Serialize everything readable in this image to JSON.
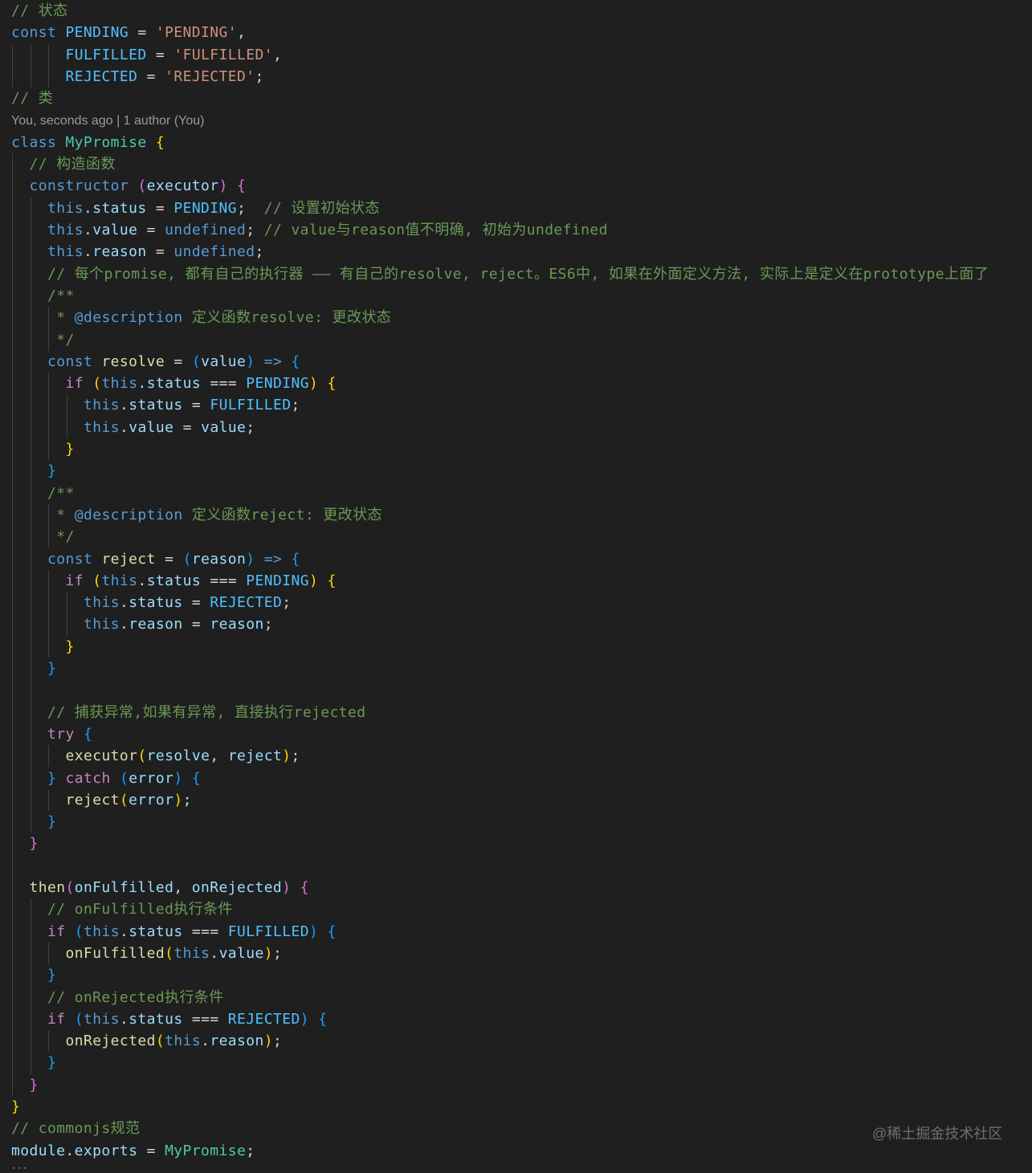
{
  "theme": {
    "background": "#1f1f1f",
    "comment": "#6a9955",
    "keyword_blue": "#569cd6",
    "keyword_control": "#c586c0",
    "variable": "#9cdcfe",
    "constant": "#4fc1ff",
    "string": "#ce9178",
    "function": "#dcdcaa",
    "class_name": "#4ec9b0",
    "text": "#d4d4d4",
    "bracket_gold": "#ffd700",
    "bracket_purple": "#da70d6",
    "bracket_blue": "#179fff",
    "docblock_tag": "#569cd6",
    "indent_guide": "#404040"
  },
  "codelens": {
    "label": "You, seconds ago | 1 author (You)",
    "after_line": 5
  },
  "watermark": "@稀土掘金技术社区",
  "lines": [
    {
      "indent": 0,
      "tokens": [
        [
          "// 状态",
          "comment"
        ]
      ]
    },
    {
      "indent": 0,
      "tokens": [
        [
          "const",
          "kw"
        ],
        [
          " ",
          "t"
        ],
        [
          "PENDING",
          "const"
        ],
        [
          " = ",
          "t"
        ],
        [
          "'PENDING'",
          "str"
        ],
        [
          ",",
          "t"
        ]
      ]
    },
    {
      "indent": 6,
      "tokens": [
        [
          "FULFILLED",
          "const"
        ],
        [
          " = ",
          "t"
        ],
        [
          "'FULFILLED'",
          "str"
        ],
        [
          ",",
          "t"
        ]
      ]
    },
    {
      "indent": 6,
      "tokens": [
        [
          "REJECTED",
          "const"
        ],
        [
          " = ",
          "t"
        ],
        [
          "'REJECTED'",
          "str"
        ],
        [
          ";",
          "t"
        ]
      ]
    },
    {
      "indent": 0,
      "tokens": [
        [
          "// 类",
          "comment"
        ]
      ]
    },
    {
      "indent": 0,
      "tokens": [
        [
          "class",
          "kw"
        ],
        [
          " ",
          "t"
        ],
        [
          "MyPromise",
          "cls"
        ],
        [
          " ",
          "t"
        ],
        [
          "{",
          "b1"
        ]
      ]
    },
    {
      "indent": 2,
      "tokens": [
        [
          "// 构造函数",
          "comment"
        ]
      ]
    },
    {
      "indent": 2,
      "tokens": [
        [
          "constructor",
          "kw"
        ],
        [
          " ",
          "t"
        ],
        [
          "(",
          "b2"
        ],
        [
          "executor",
          "var"
        ],
        [
          ")",
          "b2"
        ],
        [
          " ",
          "t"
        ],
        [
          "{",
          "b2"
        ]
      ]
    },
    {
      "indent": 4,
      "tokens": [
        [
          "this",
          "kw"
        ],
        [
          ".",
          "t"
        ],
        [
          "status",
          "var"
        ],
        [
          " = ",
          "t"
        ],
        [
          "PENDING",
          "const"
        ],
        [
          ";  ",
          "t"
        ],
        [
          "// 设置初始状态",
          "comment"
        ]
      ]
    },
    {
      "indent": 4,
      "tokens": [
        [
          "this",
          "kw"
        ],
        [
          ".",
          "t"
        ],
        [
          "value",
          "var"
        ],
        [
          " = ",
          "t"
        ],
        [
          "undefined",
          "kw"
        ],
        [
          "; ",
          "t"
        ],
        [
          "// value与reason值不明确, 初始为undefined",
          "comment"
        ]
      ]
    },
    {
      "indent": 4,
      "tokens": [
        [
          "this",
          "kw"
        ],
        [
          ".",
          "t"
        ],
        [
          "reason",
          "var"
        ],
        [
          " = ",
          "t"
        ],
        [
          "undefined",
          "kw"
        ],
        [
          ";",
          "t"
        ]
      ]
    },
    {
      "indent": 4,
      "tokens": [
        [
          "// 每个promise, 都有自己的执行器 —— 有自己的resolve, reject。ES6中, 如果在外面定义方法, 实际上是定义在prototype上面了",
          "comment"
        ]
      ]
    },
    {
      "indent": 4,
      "tokens": [
        [
          "/**",
          "comment"
        ]
      ]
    },
    {
      "indent": 5,
      "tokens": [
        [
          "* ",
          "comment"
        ],
        [
          "@description",
          "tag"
        ],
        [
          " 定义函数resolve: 更改状态",
          "comment"
        ]
      ]
    },
    {
      "indent": 5,
      "tokens": [
        [
          "*/",
          "comment"
        ]
      ]
    },
    {
      "indent": 4,
      "tokens": [
        [
          "const",
          "kw"
        ],
        [
          " ",
          "t"
        ],
        [
          "resolve",
          "func"
        ],
        [
          " = ",
          "t"
        ],
        [
          "(",
          "b3"
        ],
        [
          "value",
          "var"
        ],
        [
          ")",
          "b3"
        ],
        [
          " ",
          "t"
        ],
        [
          "=>",
          "kw"
        ],
        [
          " ",
          "t"
        ],
        [
          "{",
          "b3"
        ]
      ]
    },
    {
      "indent": 6,
      "tokens": [
        [
          "if",
          "ctl"
        ],
        [
          " ",
          "t"
        ],
        [
          "(",
          "b1"
        ],
        [
          "this",
          "kw"
        ],
        [
          ".",
          "t"
        ],
        [
          "status",
          "var"
        ],
        [
          " === ",
          "t"
        ],
        [
          "PENDING",
          "const"
        ],
        [
          ")",
          "b1"
        ],
        [
          " ",
          "t"
        ],
        [
          "{",
          "b1"
        ]
      ]
    },
    {
      "indent": 8,
      "tokens": [
        [
          "this",
          "kw"
        ],
        [
          ".",
          "t"
        ],
        [
          "status",
          "var"
        ],
        [
          " = ",
          "t"
        ],
        [
          "FULFILLED",
          "const"
        ],
        [
          ";",
          "t"
        ]
      ]
    },
    {
      "indent": 8,
      "tokens": [
        [
          "this",
          "kw"
        ],
        [
          ".",
          "t"
        ],
        [
          "value",
          "var"
        ],
        [
          " = ",
          "t"
        ],
        [
          "value",
          "var"
        ],
        [
          ";",
          "t"
        ]
      ]
    },
    {
      "indent": 6,
      "tokens": [
        [
          "}",
          "b1"
        ]
      ]
    },
    {
      "indent": 4,
      "tokens": [
        [
          "}",
          "b3"
        ]
      ]
    },
    {
      "indent": 4,
      "tokens": [
        [
          "/**",
          "comment"
        ]
      ]
    },
    {
      "indent": 5,
      "tokens": [
        [
          "* ",
          "comment"
        ],
        [
          "@description",
          "tag"
        ],
        [
          " 定义函数reject: 更改状态",
          "comment"
        ]
      ]
    },
    {
      "indent": 5,
      "tokens": [
        [
          "*/",
          "comment"
        ]
      ]
    },
    {
      "indent": 4,
      "tokens": [
        [
          "const",
          "kw"
        ],
        [
          " ",
          "t"
        ],
        [
          "reject",
          "func"
        ],
        [
          " = ",
          "t"
        ],
        [
          "(",
          "b3"
        ],
        [
          "reason",
          "var"
        ],
        [
          ")",
          "b3"
        ],
        [
          " ",
          "t"
        ],
        [
          "=>",
          "kw"
        ],
        [
          " ",
          "t"
        ],
        [
          "{",
          "b3"
        ]
      ]
    },
    {
      "indent": 6,
      "tokens": [
        [
          "if",
          "ctl"
        ],
        [
          " ",
          "t"
        ],
        [
          "(",
          "b1"
        ],
        [
          "this",
          "kw"
        ],
        [
          ".",
          "t"
        ],
        [
          "status",
          "var"
        ],
        [
          " === ",
          "t"
        ],
        [
          "PENDING",
          "const"
        ],
        [
          ")",
          "b1"
        ],
        [
          " ",
          "t"
        ],
        [
          "{",
          "b1"
        ]
      ]
    },
    {
      "indent": 8,
      "tokens": [
        [
          "this",
          "kw"
        ],
        [
          ".",
          "t"
        ],
        [
          "status",
          "var"
        ],
        [
          " = ",
          "t"
        ],
        [
          "REJECTED",
          "const"
        ],
        [
          ";",
          "t"
        ]
      ]
    },
    {
      "indent": 8,
      "tokens": [
        [
          "this",
          "kw"
        ],
        [
          ".",
          "t"
        ],
        [
          "reason",
          "var"
        ],
        [
          " = ",
          "t"
        ],
        [
          "reason",
          "var"
        ],
        [
          ";",
          "t"
        ]
      ]
    },
    {
      "indent": 6,
      "tokens": [
        [
          "}",
          "b1"
        ]
      ]
    },
    {
      "indent": 4,
      "tokens": [
        [
          "}",
          "b3"
        ]
      ]
    },
    {
      "indent": 0,
      "tokens": []
    },
    {
      "indent": 4,
      "tokens": [
        [
          "// 捕获异常,如果有异常, 直接执行rejected",
          "comment"
        ]
      ]
    },
    {
      "indent": 4,
      "tokens": [
        [
          "try",
          "ctl"
        ],
        [
          " ",
          "t"
        ],
        [
          "{",
          "b3"
        ]
      ]
    },
    {
      "indent": 6,
      "tokens": [
        [
          "executor",
          "func"
        ],
        [
          "(",
          "b1"
        ],
        [
          "resolve",
          "var"
        ],
        [
          ", ",
          "t"
        ],
        [
          "reject",
          "var"
        ],
        [
          ")",
          "b1"
        ],
        [
          ";",
          "t"
        ]
      ]
    },
    {
      "indent": 4,
      "tokens": [
        [
          "}",
          "b3"
        ],
        [
          " ",
          "t"
        ],
        [
          "catch",
          "ctl"
        ],
        [
          " ",
          "t"
        ],
        [
          "(",
          "b3"
        ],
        [
          "error",
          "var"
        ],
        [
          ")",
          "b3"
        ],
        [
          " ",
          "t"
        ],
        [
          "{",
          "b3"
        ]
      ]
    },
    {
      "indent": 6,
      "tokens": [
        [
          "reject",
          "func"
        ],
        [
          "(",
          "b1"
        ],
        [
          "error",
          "var"
        ],
        [
          ")",
          "b1"
        ],
        [
          ";",
          "t"
        ]
      ]
    },
    {
      "indent": 4,
      "tokens": [
        [
          "}",
          "b3"
        ]
      ]
    },
    {
      "indent": 2,
      "tokens": [
        [
          "}",
          "b2"
        ]
      ]
    },
    {
      "indent": 0,
      "tokens": []
    },
    {
      "indent": 2,
      "tokens": [
        [
          "then",
          "func"
        ],
        [
          "(",
          "b2"
        ],
        [
          "onFulfilled",
          "var"
        ],
        [
          ", ",
          "t"
        ],
        [
          "onRejected",
          "var"
        ],
        [
          ")",
          "b2"
        ],
        [
          " ",
          "t"
        ],
        [
          "{",
          "b2"
        ]
      ]
    },
    {
      "indent": 4,
      "tokens": [
        [
          "// onFulfilled执行条件",
          "comment"
        ]
      ]
    },
    {
      "indent": 4,
      "tokens": [
        [
          "if",
          "ctl"
        ],
        [
          " ",
          "t"
        ],
        [
          "(",
          "b3"
        ],
        [
          "this",
          "kw"
        ],
        [
          ".",
          "t"
        ],
        [
          "status",
          "var"
        ],
        [
          " === ",
          "t"
        ],
        [
          "FULFILLED",
          "const"
        ],
        [
          ")",
          "b3"
        ],
        [
          " ",
          "t"
        ],
        [
          "{",
          "b3"
        ]
      ]
    },
    {
      "indent": 6,
      "tokens": [
        [
          "onFulfilled",
          "func"
        ],
        [
          "(",
          "b1"
        ],
        [
          "this",
          "kw"
        ],
        [
          ".",
          "t"
        ],
        [
          "value",
          "var"
        ],
        [
          ")",
          "b1"
        ],
        [
          ";",
          "t"
        ]
      ]
    },
    {
      "indent": 4,
      "tokens": [
        [
          "}",
          "b3"
        ]
      ]
    },
    {
      "indent": 4,
      "tokens": [
        [
          "// onRejected执行条件",
          "comment"
        ]
      ]
    },
    {
      "indent": 4,
      "tokens": [
        [
          "if",
          "ctl"
        ],
        [
          " ",
          "t"
        ],
        [
          "(",
          "b3"
        ],
        [
          "this",
          "kw"
        ],
        [
          ".",
          "t"
        ],
        [
          "status",
          "var"
        ],
        [
          " === ",
          "t"
        ],
        [
          "REJECTED",
          "const"
        ],
        [
          ")",
          "b3"
        ],
        [
          " ",
          "t"
        ],
        [
          "{",
          "b3"
        ]
      ]
    },
    {
      "indent": 6,
      "tokens": [
        [
          "onRejected",
          "func"
        ],
        [
          "(",
          "b1"
        ],
        [
          "this",
          "kw"
        ],
        [
          ".",
          "t"
        ],
        [
          "reason",
          "var"
        ],
        [
          ")",
          "b1"
        ],
        [
          ";",
          "t"
        ]
      ]
    },
    {
      "indent": 4,
      "tokens": [
        [
          "}",
          "b3"
        ]
      ]
    },
    {
      "indent": 2,
      "tokens": [
        [
          "}",
          "b2"
        ]
      ]
    },
    {
      "indent": 0,
      "tokens": [
        [
          "}",
          "b1"
        ]
      ]
    },
    {
      "indent": 0,
      "tokens": [
        [
          "// commonjs规范",
          "comment"
        ]
      ]
    },
    {
      "indent": 0,
      "tokens": [
        [
          "module",
          "var"
        ],
        [
          ".",
          "t"
        ],
        [
          "exports",
          "var"
        ],
        [
          " = ",
          "t"
        ],
        [
          "MyPromise",
          "cls"
        ],
        [
          ";",
          "t"
        ]
      ]
    }
  ]
}
